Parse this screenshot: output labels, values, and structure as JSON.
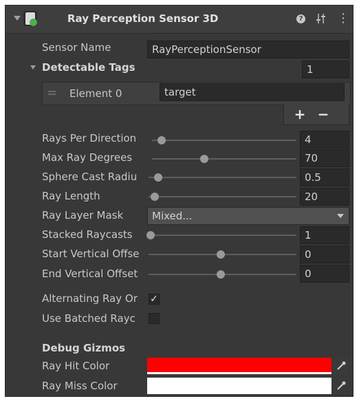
{
  "header": {
    "title": "Ray Perception Sensor 3D",
    "help_glyph": "❓",
    "settings_glyph": "⚙",
    "menu_glyph": "⋮"
  },
  "sensor_name": {
    "label": "Sensor Name",
    "value": "RayPerceptionSensor"
  },
  "detectable_tags": {
    "label": "Detectable Tags",
    "count": "1",
    "elements": [
      {
        "label": "Element 0",
        "value": "target"
      }
    ],
    "add_label": "+",
    "remove_label": "−"
  },
  "rays_per_direction": {
    "label": "Rays Per Direction",
    "value": "4",
    "fraction": 0.06
  },
  "max_ray_degrees": {
    "label": "Max Ray Degrees",
    "value": "70",
    "fraction": 0.39
  },
  "sphere_cast_radius": {
    "label": "Sphere Cast Radiu",
    "value": "0.5",
    "fraction": 0.03
  },
  "ray_length": {
    "label": "Ray Length",
    "value": "20",
    "fraction": 0.02
  },
  "ray_layer_mask": {
    "label": "Ray Layer Mask",
    "value": "Mixed..."
  },
  "stacked_raycasts": {
    "label": "Stacked Raycasts",
    "value": "1",
    "fraction": 0.0
  },
  "start_vertical_offset": {
    "label": "Start Vertical Offse",
    "value": "0",
    "fraction": 0.5
  },
  "end_vertical_offset": {
    "label": "End Vertical Offset",
    "value": "0",
    "fraction": 0.5
  },
  "alternating_ray_order": {
    "label": "Alternating Ray Or",
    "checked": true,
    "check_glyph": "✓"
  },
  "use_batched_raycasts": {
    "label": "Use Batched Rayc",
    "checked": false
  },
  "debug": {
    "heading": "Debug Gizmos",
    "ray_hit_color": {
      "label": "Ray Hit Color",
      "color": "#ff0000"
    },
    "ray_miss_color": {
      "label": "Ray Miss Color",
      "color": "#ffffff"
    }
  },
  "colors": {
    "panel_bg": "#383838",
    "header_bg": "#3e3e3e",
    "field_bg": "#2a2a2a",
    "component_icon_green": "#4caf50"
  }
}
